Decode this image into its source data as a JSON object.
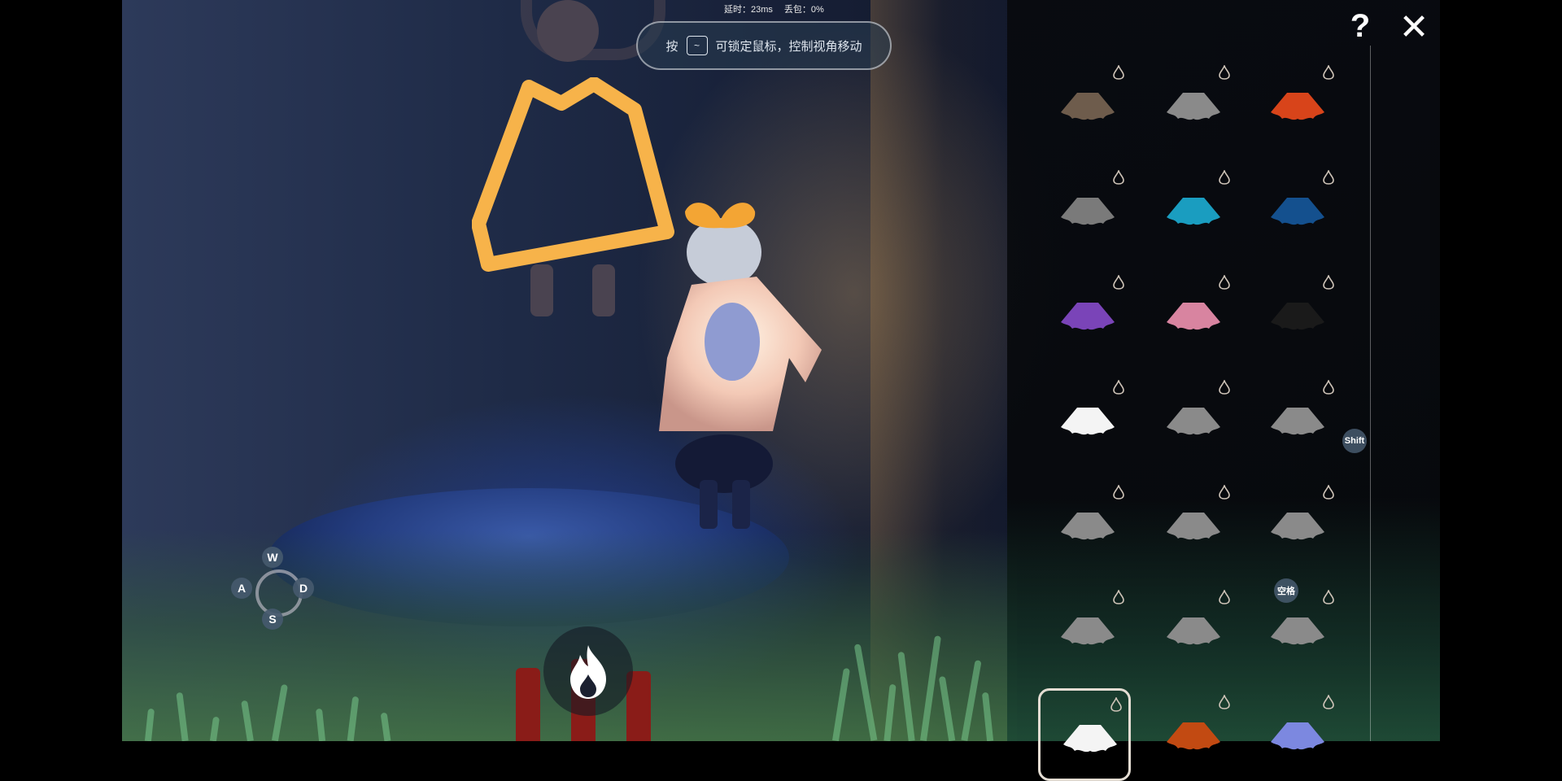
{
  "status": {
    "latency_label": "延时：23ms",
    "packet_loss_label": "丢包：0%"
  },
  "hint": {
    "prefix": "按",
    "key": "~",
    "suffix": "可锁定鼠标，控制视角移动"
  },
  "controls": {
    "w": "W",
    "a": "A",
    "s": "S",
    "d": "D",
    "shift": "Shift",
    "space": "空格"
  },
  "panel": {
    "help_glyph": "?",
    "close_glyph": "✕",
    "capes": [
      {
        "color": "#6e5c4c"
      },
      {
        "color": "#8a8a8a"
      },
      {
        "color": "#d8441a"
      },
      {
        "color": "#7a7a7a"
      },
      {
        "color": "#1a9dc0"
      },
      {
        "color": "#14508e"
      },
      {
        "color": "#7a44b8"
      },
      {
        "color": "#d884a0"
      },
      {
        "color": "#1a1a1a"
      },
      {
        "color": "#f4f4f4"
      },
      {
        "color": "#8a8a8a"
      },
      {
        "color": "#8a8a8a"
      },
      {
        "color": "#8a8a8a"
      },
      {
        "color": "#8a8a8a"
      },
      {
        "color": "#8a8a8a"
      },
      {
        "color": "#8a8a8a"
      },
      {
        "color": "#8a8a8a"
      },
      {
        "color": "#8a8a8a"
      },
      {
        "color": "#f4f4f4"
      },
      {
        "color": "#c24a12"
      },
      {
        "color": "#7c88e0"
      }
    ],
    "selected_index": 18
  }
}
